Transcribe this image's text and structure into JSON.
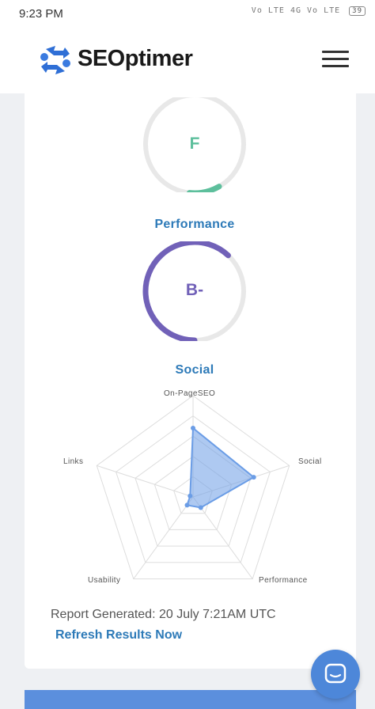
{
  "status_bar": {
    "time": "9:23 PM",
    "icons": "Vo LTE  4G  Vo LTE",
    "battery": "39"
  },
  "header": {
    "logo_text": "SEOptimer",
    "logo_icon": "seoptimer-gear-arrows-icon",
    "menu_icon": "hamburger-menu-icon"
  },
  "scores": {
    "performance": {
      "grade": "F",
      "title": "Performance",
      "color": "#5dbf9c",
      "fraction": 0.1
    },
    "social": {
      "grade": "B-",
      "title": "Social",
      "color": "#7161b8",
      "fraction": 0.62
    }
  },
  "chart_data": {
    "type": "radar",
    "axes": [
      "On-Page SEO",
      "Social",
      "Performance",
      "Usability",
      "Links"
    ],
    "axis_labels_display": [
      "On-PageSEO",
      "Social",
      "Performance",
      "Usability",
      "Links"
    ],
    "values": [
      0.68,
      0.63,
      0.13,
      0.1,
      0.03
    ],
    "max": 1,
    "rings": 5,
    "fill_color": "#6b9de6",
    "grid_color": "#dddddd"
  },
  "report": {
    "generated_text": "Report Generated: 20 July 7:21AM UTC",
    "refresh_label": "Refresh Results Now"
  },
  "chat": {
    "icon": "chat-bubble-icon",
    "color": "#4d87d9"
  }
}
